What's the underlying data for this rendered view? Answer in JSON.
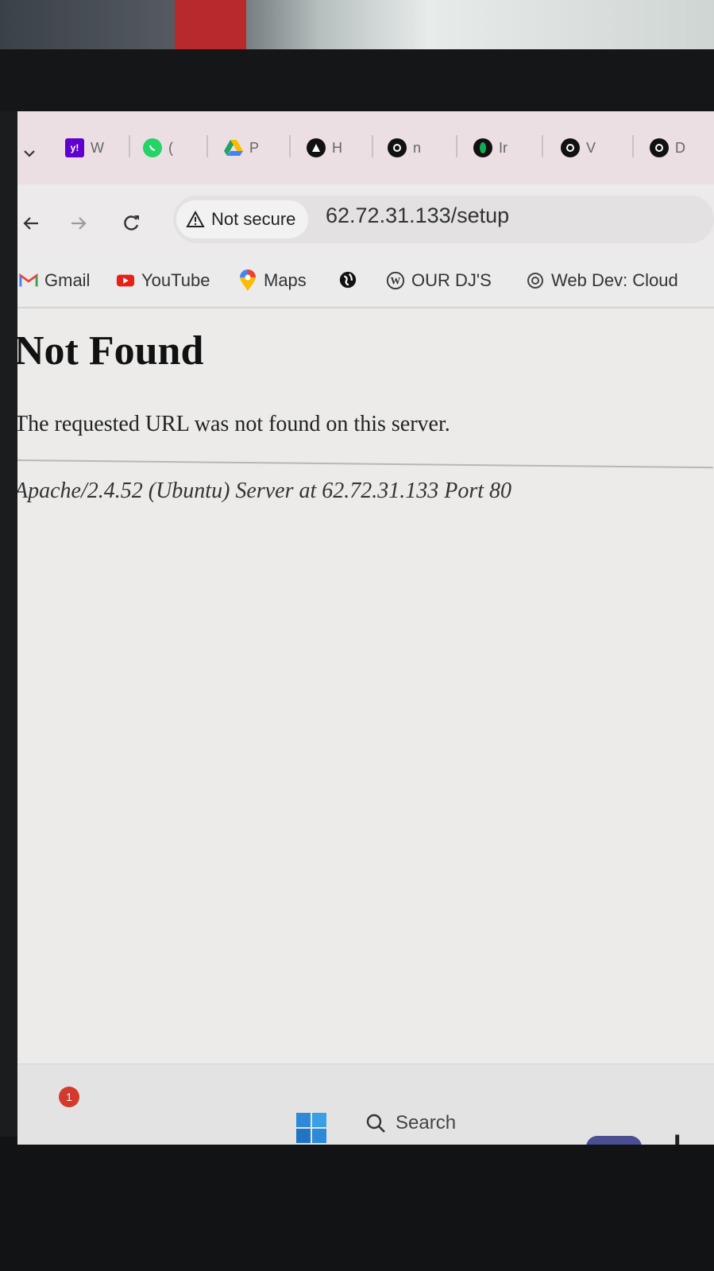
{
  "browser": {
    "tabs": [
      {
        "icon": "yahoo-icon",
        "label": "W",
        "color": "#6001d2"
      },
      {
        "icon": "whatsapp-icon",
        "label": "(",
        "color": "#25d366"
      },
      {
        "icon": "google-drive-icon",
        "label": "P",
        "color": "#1fa463"
      },
      {
        "icon": "app-icon",
        "label": "H",
        "color": "#111111"
      },
      {
        "icon": "github-icon",
        "label": "n",
        "color": "#111111"
      },
      {
        "icon": "mongodb-icon",
        "label": "Ir",
        "color": "#13aa52"
      },
      {
        "icon": "github-icon",
        "label": "V",
        "color": "#111111"
      },
      {
        "icon": "github-icon",
        "label": "D",
        "color": "#111111"
      }
    ],
    "security_label": "Not secure",
    "url": "62.72.31.133/setup",
    "bookmarks": [
      {
        "icon": "gmail-icon",
        "label": "Gmail"
      },
      {
        "icon": "youtube-icon",
        "label": "YouTube"
      },
      {
        "icon": "maps-icon",
        "label": "Maps"
      },
      {
        "icon": "globe-icon",
        "label": ""
      },
      {
        "icon": "wordpress-icon",
        "label": "OUR DJ'S"
      },
      {
        "icon": "openai-icon",
        "label": "Web Dev: Cloud"
      }
    ]
  },
  "page": {
    "title": "Not Found",
    "message": "The requested URL was not found on this server.",
    "address": "Apache/2.4.52 (Ubuntu) Server at 62.72.31.133 Port 80"
  },
  "taskbar": {
    "notification_count": "1",
    "search_label": "Search",
    "tray_letter": "L"
  }
}
